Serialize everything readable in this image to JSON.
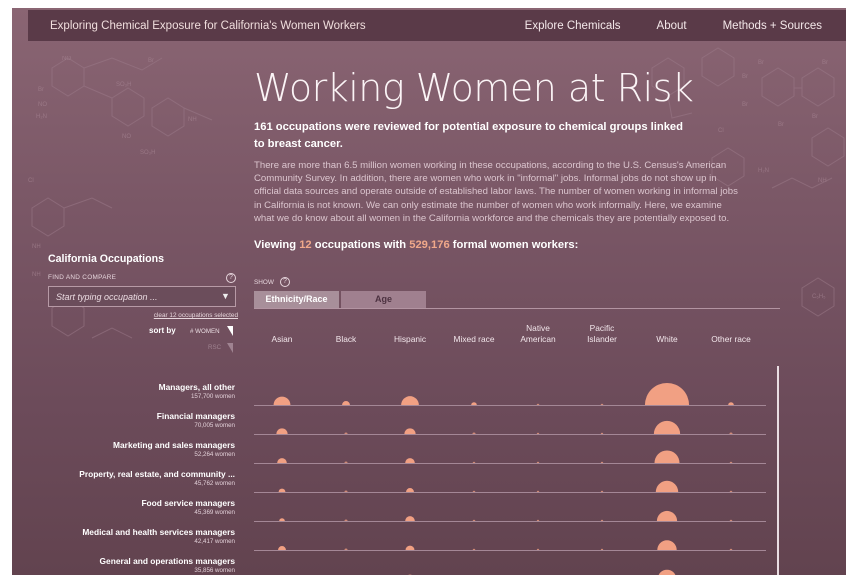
{
  "nav": {
    "site_title": "Exploring Chemical Exposure for California's Women Workers",
    "links": [
      "Explore Chemicals",
      "About",
      "Methods + Sources"
    ]
  },
  "hero": {
    "headline": "Working Women at Risk",
    "lead": "161 occupations were reviewed for potential exposure to chemical groups linked to breast cancer.",
    "body": "There are more than 6.5 million women working in these occupations, according to the U.S. Census's American Community Survey. In addition, there are women who work in \"informal\" jobs. Informal jobs do not show up in official data sources and operate outside of established labor laws. The number of women working in informal jobs in California is not known. We can only estimate the number of women who work informally. Here, we examine what we do know about all women in the California workforce and the chemicals they are potentially exposed to.",
    "viewing_prefix": "Viewing ",
    "viewing_count": "12",
    "viewing_mid": " occupations with ",
    "viewing_workers": "529,176",
    "viewing_suffix": " formal women workers:"
  },
  "sidebar": {
    "title": "California Occupations",
    "find_label": "FIND AND COMPARE",
    "input_placeholder": "Start typing occupation ...",
    "clear_text": "clear 12 occupations selected",
    "sort_label": "sort by",
    "sort_options": [
      "# WOMEN",
      "RSC"
    ]
  },
  "view": {
    "show_label": "SHOW",
    "tabs": [
      "Ethnicity/Race",
      "Age"
    ]
  },
  "columns": [
    "Asian",
    "Black",
    "Hispanic",
    "Mixed race",
    "Native American",
    "Pacific Islander",
    "White",
    "Other race"
  ],
  "rows": [
    {
      "name": "Managers, all other",
      "count": "157,700 women",
      "share": [
        0.09,
        0.02,
        0.1,
        0.01,
        0.002,
        0.002,
        0.62,
        0.01
      ]
    },
    {
      "name": "Financial managers",
      "count": "70,005 women",
      "share": [
        0.04,
        0.003,
        0.04,
        0.003,
        0.001,
        0.001,
        0.22,
        0.003
      ]
    },
    {
      "name": "Marketing and sales managers",
      "count": "52,264 women",
      "share": [
        0.03,
        0.003,
        0.03,
        0.002,
        0.001,
        0.001,
        0.2,
        0.002
      ]
    },
    {
      "name": "Property, real estate, and community ...",
      "count": "45,762 women",
      "share": [
        0.015,
        0.003,
        0.02,
        0.002,
        0.001,
        0.001,
        0.16,
        0.002
      ]
    },
    {
      "name": "Food service managers",
      "count": "45,369 women",
      "share": [
        0.01,
        0.003,
        0.03,
        0.002,
        0.001,
        0.001,
        0.13,
        0.002
      ]
    },
    {
      "name": "Medical and health services managers",
      "count": "42,417 women",
      "share": [
        0.02,
        0.003,
        0.025,
        0.002,
        0.001,
        0.001,
        0.12,
        0.002
      ]
    },
    {
      "name": "General and operations managers",
      "count": "35,856 women",
      "share": [
        0.02,
        0.003,
        0.025,
        0.002,
        0.001,
        0.001,
        0.11,
        0.002
      ]
    }
  ],
  "colors": {
    "bubble": "#f1a083",
    "accent": "#f0a88a",
    "background": "#7a5766",
    "nav": "#5a3a48"
  }
}
